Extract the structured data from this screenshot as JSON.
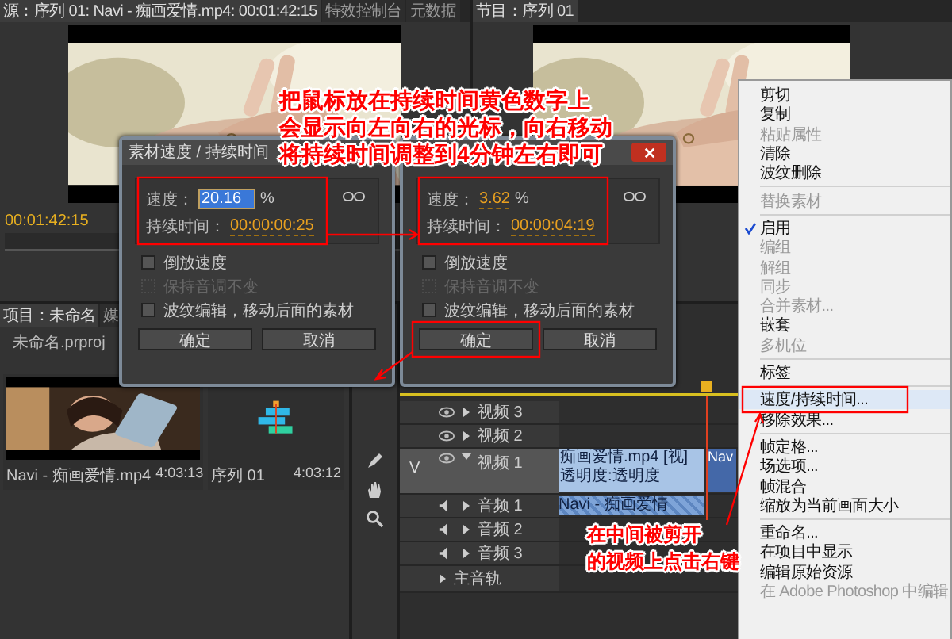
{
  "source_monitor": {
    "tabs": [
      {
        "label": "源：序列 01: Navi - 痴画爱情.mp4: 00:01:42:15",
        "selected": true
      },
      {
        "label": "特效控制台",
        "selected": false
      },
      {
        "label": "元数据",
        "selected": false
      }
    ],
    "timecode": "00:01:42:15"
  },
  "program_monitor": {
    "title": "节目：序列 01"
  },
  "project_panel": {
    "tabs": [
      {
        "label": "项目：未命名",
        "selected": true
      },
      {
        "label": "媒",
        "selected": false
      }
    ],
    "file": "未命名.prproj",
    "items": [
      {
        "kind": "clip",
        "name": "Navi - 痴画爱情.mp4",
        "duration": "4:03:13"
      },
      {
        "kind": "sequence",
        "name": "序列 01",
        "duration": "4:03:12"
      }
    ]
  },
  "timeline": {
    "tracks": [
      {
        "kind": "video",
        "name": "视频 3",
        "expanded": false
      },
      {
        "kind": "video",
        "name": "视频 2",
        "expanded": false
      },
      {
        "kind": "video",
        "name": "视频 1",
        "expanded": true,
        "target": "V"
      },
      {
        "kind": "audio",
        "name": "音频 1",
        "expanded": false
      },
      {
        "kind": "audio",
        "name": "音频 2",
        "expanded": false
      },
      {
        "kind": "audio",
        "name": "音频 3",
        "expanded": false
      },
      {
        "kind": "master",
        "name": "主音轨",
        "expanded": false
      }
    ],
    "video_clip": "痴画爱情.mp4 [视] 透明度:透明度",
    "next_clip": "Nav",
    "audio_clip": "Navi - 痴画爱情"
  },
  "dialogs": [
    {
      "title": "素材速度 / 持续时间",
      "show_close": false,
      "speed_label": "速度：",
      "speed": "20.16",
      "speed_selected": true,
      "unit": "%",
      "duration_label": "持续时间：",
      "duration": "00:00:00:25",
      "options": [
        {
          "label": "倒放速度",
          "checked": false,
          "disabled": false
        },
        {
          "label": "保持音调不变",
          "checked": false,
          "disabled": true
        },
        {
          "label": "波纹编辑，移动后面的素材",
          "checked": false,
          "disabled": false
        }
      ],
      "buttons": [
        "确定",
        "取消"
      ]
    },
    {
      "show_close": true,
      "speed_label": "速度：",
      "speed": "3.62",
      "speed_selected": false,
      "unit": "%",
      "duration_label": "持续时间：",
      "duration": "00:00:04:19",
      "options": [
        {
          "label": "倒放速度",
          "checked": false,
          "disabled": false
        },
        {
          "label": "保持音调不变",
          "checked": false,
          "disabled": true
        },
        {
          "label": "波纹编辑，移动后面的素材",
          "checked": false,
          "disabled": false
        }
      ],
      "buttons": [
        "确定",
        "取消"
      ]
    }
  ],
  "context_menu": {
    "sections": [
      [
        {
          "label": "剪切",
          "disabled": false,
          "checked": false,
          "selected": false
        },
        {
          "label": "复制",
          "disabled": false,
          "checked": false,
          "selected": false
        },
        {
          "label": "粘贴属性",
          "disabled": true,
          "checked": false,
          "selected": false
        },
        {
          "label": "清除",
          "disabled": false,
          "checked": false,
          "selected": false
        },
        {
          "label": "波纹删除",
          "disabled": false,
          "checked": false,
          "selected": false
        }
      ],
      [
        {
          "label": "替换素材",
          "disabled": true,
          "checked": false,
          "selected": false
        }
      ],
      [
        {
          "label": "启用",
          "disabled": false,
          "checked": true,
          "selected": false
        },
        {
          "label": "编组",
          "disabled": true,
          "checked": false,
          "selected": false
        },
        {
          "label": "解组",
          "disabled": true,
          "checked": false,
          "selected": false
        },
        {
          "label": "同步",
          "disabled": true,
          "checked": false,
          "selected": false
        },
        {
          "label": "合并素材...",
          "disabled": true,
          "checked": false,
          "selected": false
        },
        {
          "label": "嵌套",
          "disabled": false,
          "checked": false,
          "selected": false
        },
        {
          "label": "多机位",
          "disabled": true,
          "checked": false,
          "selected": false
        }
      ],
      [
        {
          "label": "标签",
          "disabled": false,
          "checked": false,
          "selected": false
        }
      ],
      [
        {
          "label": "速度/持续时间...",
          "disabled": false,
          "checked": false,
          "selected": true
        },
        {
          "label": "移除效果...",
          "disabled": false,
          "checked": false,
          "selected": false
        }
      ],
      [
        {
          "label": "帧定格...",
          "disabled": false,
          "checked": false,
          "selected": false
        },
        {
          "label": "场选项...",
          "disabled": false,
          "checked": false,
          "selected": false
        },
        {
          "label": "帧混合",
          "disabled": false,
          "checked": false,
          "selected": false
        },
        {
          "label": "缩放为当前画面大小",
          "disabled": false,
          "checked": false,
          "selected": false
        }
      ],
      [
        {
          "label": "重命名...",
          "disabled": false,
          "checked": false,
          "selected": false
        },
        {
          "label": "在项目中显示",
          "disabled": false,
          "checked": false,
          "selected": false
        },
        {
          "label": "编辑原始资源",
          "disabled": false,
          "checked": false,
          "selected": false
        },
        {
          "label": "在 Adobe Photoshop 中编辑",
          "disabled": true,
          "checked": false,
          "selected": false
        }
      ]
    ]
  },
  "annotations": [
    {
      "kind": "top",
      "lines": [
        "把鼠标放在持续时间黄色数字上",
        "会显示向左向右的光标，向右移动",
        "将持续时间调整到4分钟左右即可"
      ]
    },
    {
      "kind": "bottom",
      "lines": [
        "在中间被剪开",
        "的视频上点击右键"
      ]
    }
  ]
}
